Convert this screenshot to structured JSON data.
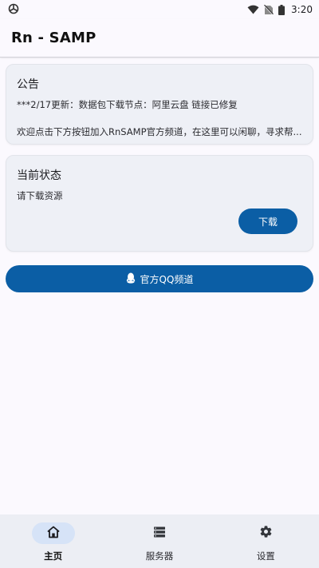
{
  "status_bar": {
    "time": "3:20",
    "icons": [
      "app-notification-icon",
      "wifi-icon",
      "no-sim-icon",
      "battery-icon"
    ]
  },
  "app_bar": {
    "title": "Rn - SAMP"
  },
  "notice_card": {
    "title": "公告",
    "line1": "***2/17更新：数据包下载节点：阿里云盘 链接已修复",
    "line2": "欢迎点击下方按钮加入RnSAMP官方频道，在这里可以闲聊，寻求帮..."
  },
  "status_card": {
    "title": "当前状态",
    "text": "请下载资源",
    "download_label": "下载"
  },
  "qq_button": {
    "label": "官方QQ频道",
    "icon": "qq-icon"
  },
  "bottom_nav": {
    "items": [
      {
        "label": "主页",
        "icon": "home-icon",
        "active": true
      },
      {
        "label": "服务器",
        "icon": "server-list-icon",
        "active": false
      },
      {
        "label": "设置",
        "icon": "settings-gear-icon",
        "active": false
      }
    ]
  },
  "colors": {
    "primary": "#0b5ea5",
    "card_bg": "#eef0f6",
    "nav_bg": "#eceef4",
    "nav_active_pill": "#d6e3f7",
    "page_bg": "#fbf9fe"
  }
}
